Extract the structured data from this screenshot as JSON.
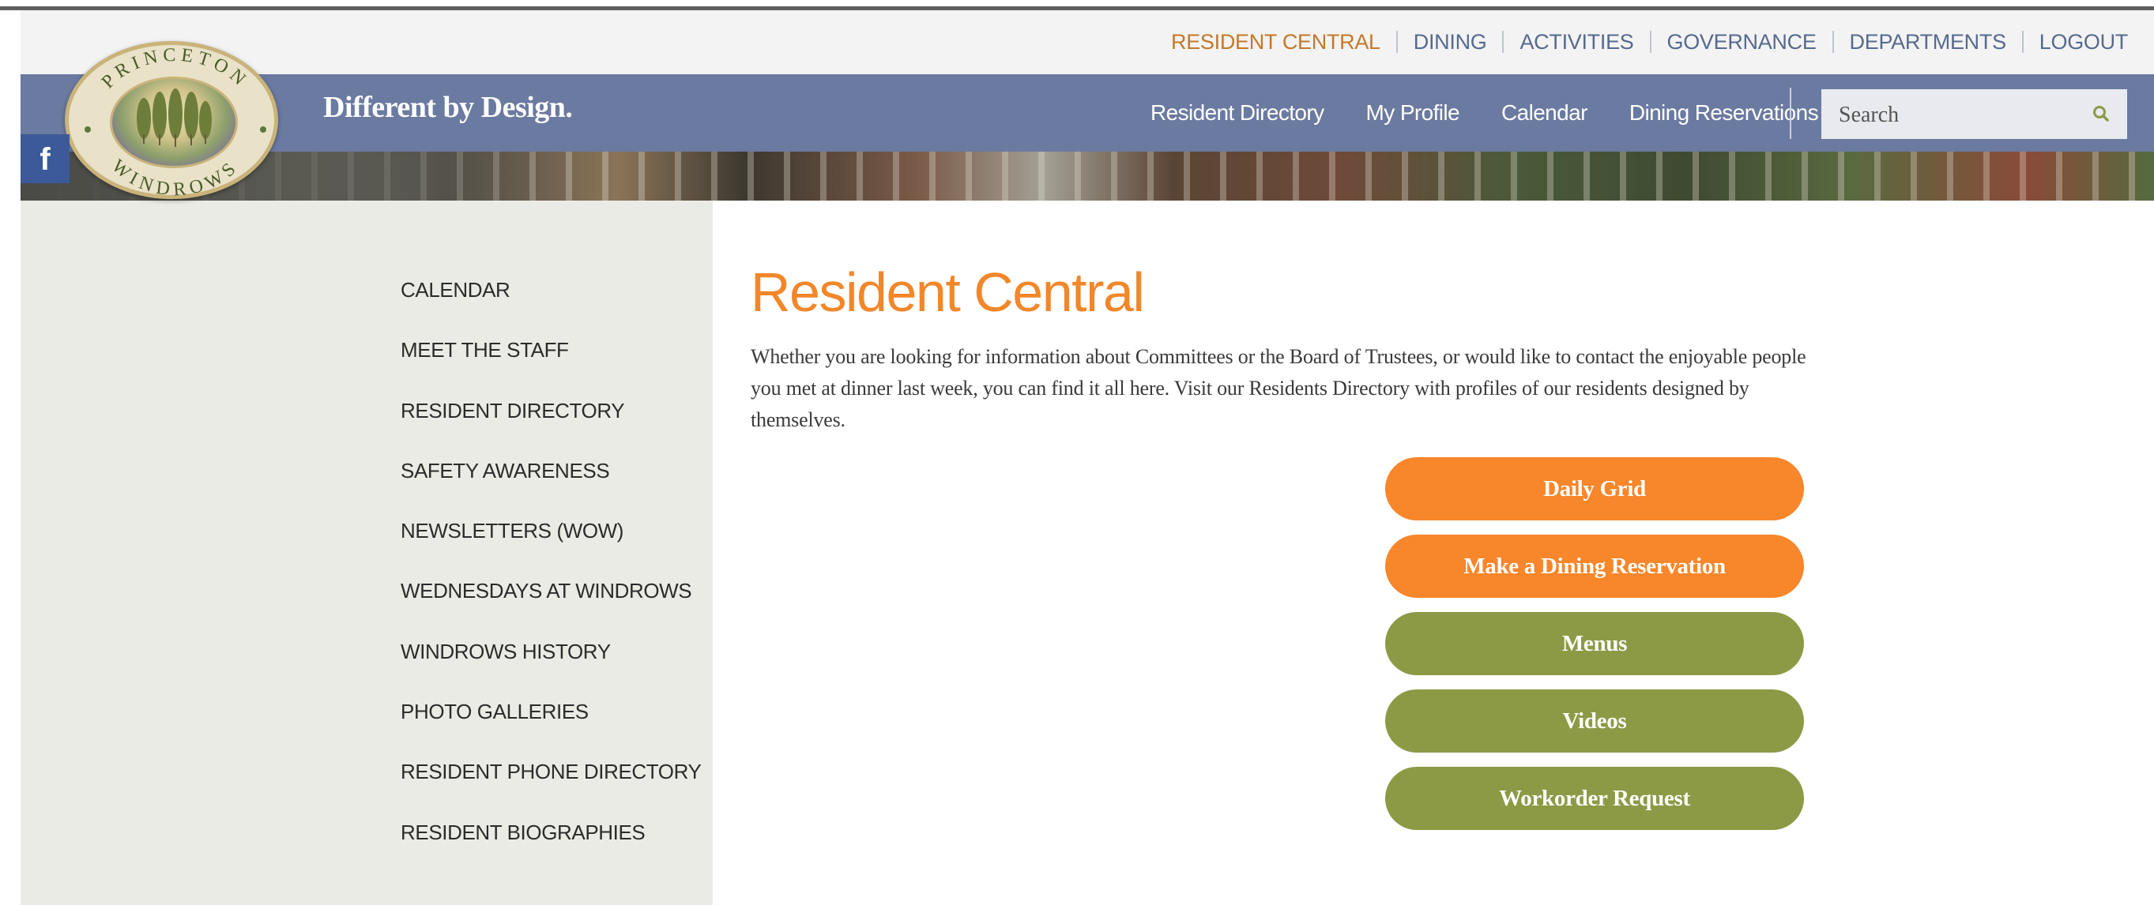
{
  "utility_nav": {
    "items": [
      {
        "label": "RESIDENT CENTRAL",
        "active": true
      },
      {
        "label": "DINING"
      },
      {
        "label": "ACTIVITIES"
      },
      {
        "label": "GOVERNANCE"
      },
      {
        "label": "DEPARTMENTS"
      },
      {
        "label": "LOGOUT"
      }
    ]
  },
  "header": {
    "logo_text_top": "PRINCETON",
    "logo_text_bottom": "WINDROWS",
    "tagline": "Different by Design.",
    "main_nav": [
      "Resident Directory",
      "My Profile",
      "Calendar",
      "Dining Reservations"
    ],
    "search": {
      "placeholder": "Search"
    }
  },
  "social": {
    "facebook_icon": "f"
  },
  "sidebar": {
    "items": [
      "CALENDAR",
      "MEET THE STAFF",
      "RESIDENT DIRECTORY",
      "SAFETY AWARENESS",
      "NEWSLETTERS (WOW)",
      "WEDNESDAYS AT WINDROWS",
      "WINDROWS HISTORY",
      "PHOTO GALLERIES",
      "RESIDENT PHONE DIRECTORY",
      "RESIDENT BIOGRAPHIES"
    ]
  },
  "main": {
    "title": "Resident Central",
    "intro": "Whether you are looking for information about Committees or the Board of Trustees, or would like to contact the enjoyable people you met at dinner last week, you can find it all here. Visit our Residents Directory with profiles of our residents designed by themselves.",
    "buttons": [
      {
        "label": "Daily Grid",
        "color": "#f8862a"
      },
      {
        "label": "Make a Dining Reservation",
        "color": "#f8862a"
      },
      {
        "label": "Menus",
        "color": "#8c9a45"
      },
      {
        "label": "Videos",
        "color": "#8c9a45"
      },
      {
        "label": "Workorder Request",
        "color": "#8c9a45"
      }
    ]
  },
  "colors": {
    "accent_orange": "#f2872a",
    "header_blue": "#6b7aa0",
    "olive": "#8c9a45",
    "sidebar_bg": "#ebebe5"
  }
}
